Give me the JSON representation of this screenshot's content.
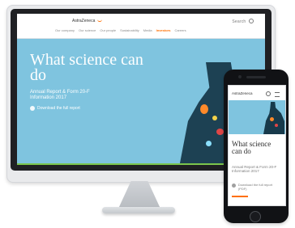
{
  "desktop": {
    "logo": "AstraZeneca",
    "search": "Search",
    "nav": [
      "Our company",
      "Our science",
      "Our people",
      "Sustainability",
      "Media",
      "Investors",
      "Careers"
    ],
    "active_nav": "Investors",
    "hero_title": "What science can do",
    "hero_subtitle": "Annual Report & Form 20-F Information 2017",
    "download_label": "Download the full report"
  },
  "mobile": {
    "logo": "AstraZeneca",
    "hero_title": "What science can do",
    "hero_subtitle": "Annual Report & Form 20-F Information 2017",
    "download_label": "Download the full report (PDF)"
  }
}
